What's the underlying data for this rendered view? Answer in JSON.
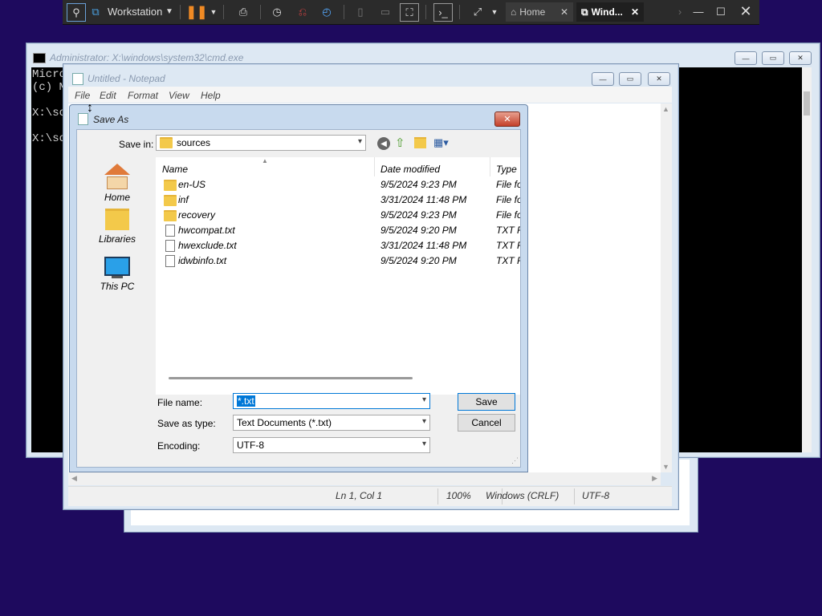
{
  "vm_toolbar": {
    "workstation_label": "Workstation",
    "tabs": [
      {
        "label": "Home",
        "active": false
      },
      {
        "label": "Wind...",
        "active": true
      }
    ]
  },
  "cmd": {
    "title": "Administrator: X:\\windows\\system32\\cmd.exe",
    "lines": [
      "Micro",
      "(c) M",
      "",
      "X:\\so",
      "",
      "X:\\so"
    ]
  },
  "notepad": {
    "title": "Untitled - Notepad",
    "menu": [
      "File",
      "Edit",
      "Format",
      "View",
      "Help"
    ],
    "status": {
      "position": "Ln 1, Col 1",
      "zoom": "100%",
      "line_ending": "Windows (CRLF)",
      "encoding": "UTF-8"
    }
  },
  "save_as": {
    "title": "Save As",
    "save_in_label": "Save in:",
    "save_in_value": "sources",
    "places": [
      "Home",
      "Libraries",
      "This PC"
    ],
    "columns": {
      "name": "Name",
      "date": "Date modified",
      "type": "Type"
    },
    "files": [
      {
        "name": "en-US",
        "date": "9/5/2024 9:23 PM",
        "type": "File fo",
        "kind": "folder"
      },
      {
        "name": "inf",
        "date": "3/31/2024 11:48 PM",
        "type": "File fo",
        "kind": "folder"
      },
      {
        "name": "recovery",
        "date": "9/5/2024 9:23 PM",
        "type": "File fo",
        "kind": "folder"
      },
      {
        "name": "hwcompat.txt",
        "date": "9/5/2024 9:20 PM",
        "type": "TXT F",
        "kind": "file"
      },
      {
        "name": "hwexclude.txt",
        "date": "3/31/2024 11:48 PM",
        "type": "TXT F",
        "kind": "file"
      },
      {
        "name": "idwbinfo.txt",
        "date": "9/5/2024 9:20 PM",
        "type": "TXT F",
        "kind": "file"
      }
    ],
    "file_name_label": "File name:",
    "file_name_value": "*.txt",
    "save_type_label": "Save as type:",
    "save_type_value": "Text Documents (*.txt)",
    "encoding_label": "Encoding:",
    "encoding_value": "UTF-8",
    "save_button": "Save",
    "cancel_button": "Cancel"
  }
}
